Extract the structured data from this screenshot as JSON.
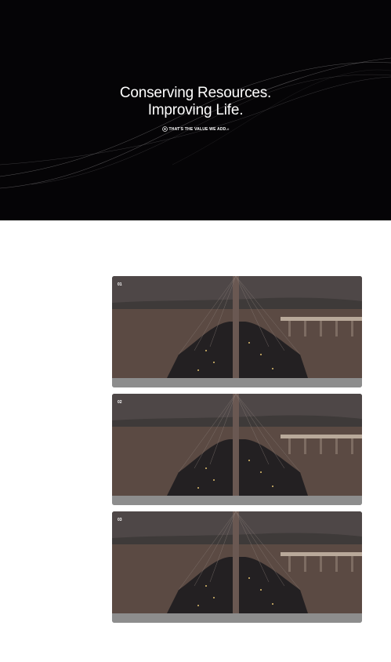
{
  "hero": {
    "title_line1": "Conserving Resources.",
    "title_line2": "Improving Life.",
    "tagline": "THAT'S THE VALUE WE ADD.",
    "tagline_mark": "®",
    "background_color": "#050406",
    "icon": "circle-plus-icon"
  },
  "videos": [
    {
      "number": "01"
    },
    {
      "number": "02"
    },
    {
      "number": "03"
    }
  ]
}
